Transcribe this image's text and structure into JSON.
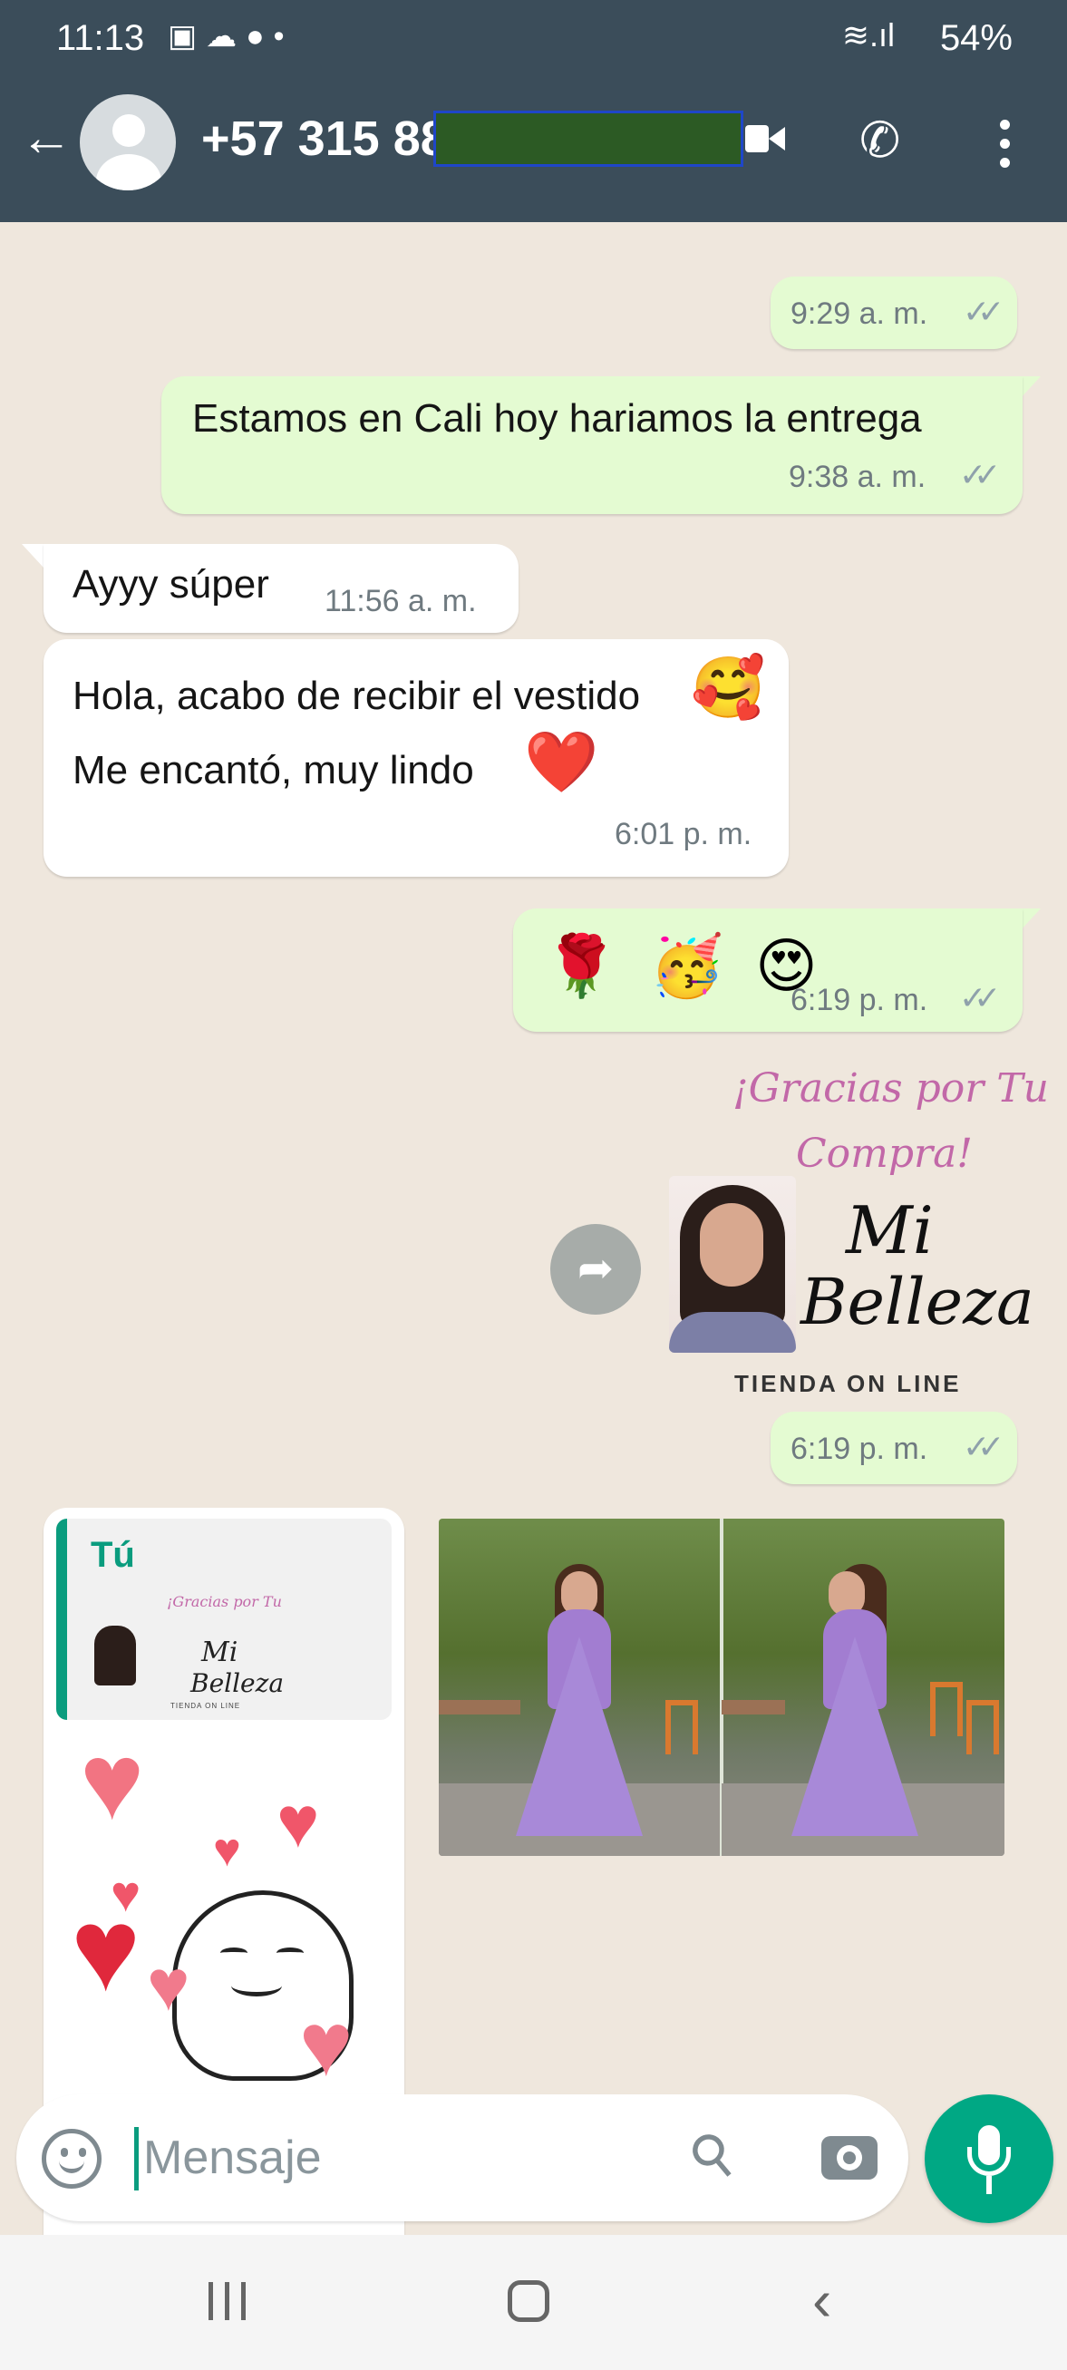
{
  "status_bar": {
    "time": "11:13",
    "battery": "54%"
  },
  "header": {
    "contact_name": "+57 315 88"
  },
  "messages": [
    {
      "text": "",
      "time": "9:29 a. m."
    },
    {
      "text": "Estamos en Cali hoy hariamos la entrega",
      "time": "9:38 a. m."
    },
    {
      "text": "Ayyy súper",
      "time": "11:56 a. m."
    },
    {
      "line1": "Hola, acabo de recibir el vestido",
      "line2": "Me encantó, muy lindo",
      "time": "6:01 p. m."
    },
    {
      "emojis": "🌹 🥳 😍",
      "time": "6:19 p. m."
    },
    {
      "time": "6:19 p. m."
    }
  ],
  "sticker": {
    "title_line1": "¡Gracias por Tu",
    "title_line2": "Compra!",
    "brand_line1": "Mi",
    "brand_line2": "Belleza",
    "subtitle": "TIENDA ON LINE"
  },
  "reply": {
    "quoted_author": "Tú"
  },
  "input": {
    "placeholder": "Mensaje"
  },
  "colors": {
    "header_bg": "#3b4d5a",
    "outgoing_bubble": "#e4fbd2",
    "incoming_bubble": "#ffffff",
    "accent": "#00a884",
    "chat_bg": "#efe7dd"
  }
}
